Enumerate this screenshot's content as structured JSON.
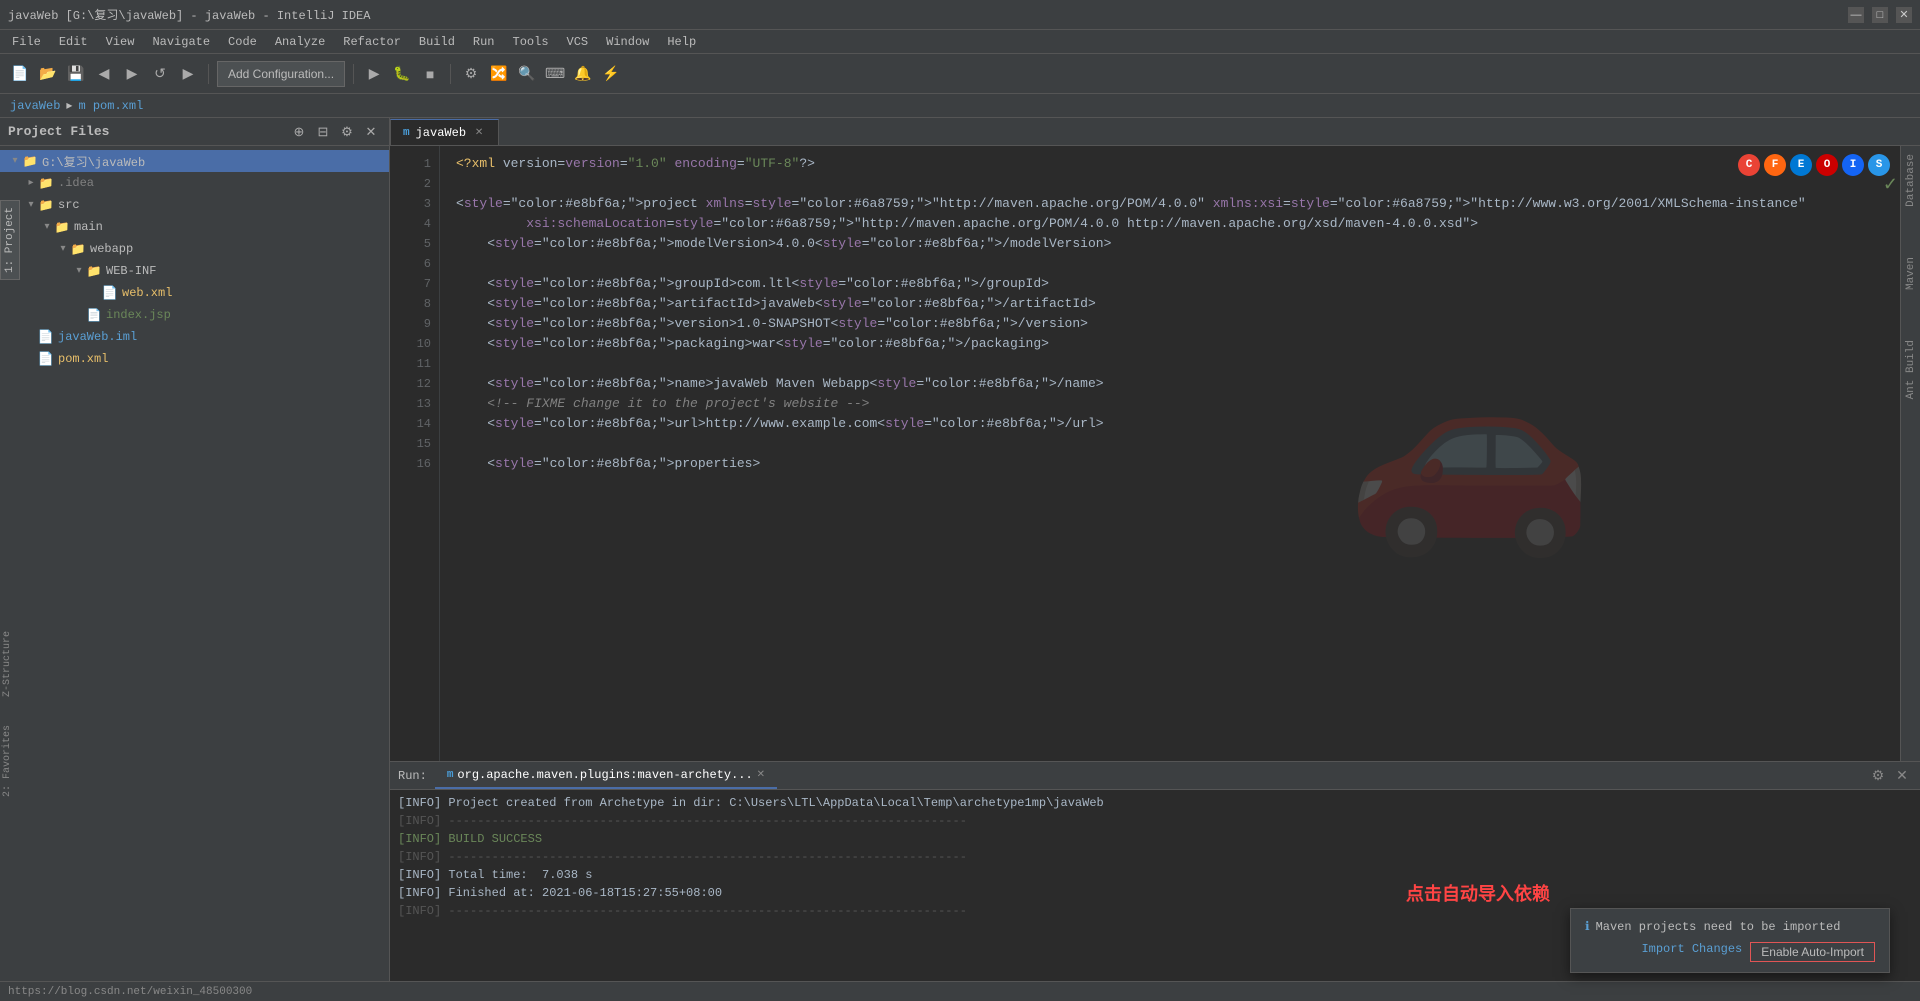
{
  "window": {
    "title": "javaWeb [G:\\复习\\javaWeb] - javaWeb - IntelliJ IDEA",
    "min_label": "—",
    "max_label": "□",
    "close_label": "✕"
  },
  "menu": {
    "items": [
      "File",
      "Edit",
      "View",
      "Navigate",
      "Code",
      "Analyze",
      "Refactor",
      "Build",
      "Run",
      "Tools",
      "VCS",
      "Window",
      "Help"
    ]
  },
  "toolbar": {
    "add_config_label": "Add Configuration...",
    "run_icon": "▶",
    "debug_icon": "🐛",
    "stop_icon": "■",
    "build_icon": "🔨"
  },
  "breadcrumb": {
    "parts": [
      "javaWeb",
      "▸",
      "m pom.xml"
    ]
  },
  "sidebar": {
    "title": "Project Files",
    "tree": [
      {
        "indent": 0,
        "icon": "📁",
        "label": "G:\\复习\\javaWeb",
        "expanded": true,
        "arrow": "▾"
      },
      {
        "indent": 1,
        "icon": "📁",
        "label": ".idea",
        "expanded": false,
        "arrow": "▸"
      },
      {
        "indent": 1,
        "icon": "📁",
        "label": "src",
        "expanded": true,
        "arrow": "▾"
      },
      {
        "indent": 2,
        "icon": "📁",
        "label": "main",
        "expanded": true,
        "arrow": "▾"
      },
      {
        "indent": 3,
        "icon": "📁",
        "label": "webapp",
        "expanded": true,
        "arrow": "▾"
      },
      {
        "indent": 4,
        "icon": "📁",
        "label": "WEB-INF",
        "expanded": true,
        "arrow": "▾"
      },
      {
        "indent": 5,
        "icon": "📄",
        "label": "web.xml",
        "expanded": false,
        "arrow": ""
      },
      {
        "indent": 4,
        "icon": "📄",
        "label": "index.jsp",
        "expanded": false,
        "arrow": ""
      },
      {
        "indent": 1,
        "icon": "📄",
        "label": "javaWeb.iml",
        "expanded": false,
        "arrow": ""
      },
      {
        "indent": 1,
        "icon": "📄",
        "label": "pom.xml",
        "expanded": false,
        "arrow": ""
      }
    ]
  },
  "editor": {
    "tab_label": "javaWeb",
    "tab_icon": "m",
    "lines": [
      {
        "num": 1,
        "content": "<?xml version=\"1.0\" encoding=\"UTF-8\"?>"
      },
      {
        "num": 2,
        "content": ""
      },
      {
        "num": 3,
        "content": "<project xmlns=\"http://maven.apache.org/POM/4.0.0\" xmlns:xsi=\"http://www.w3.org/2001/XMLSchema-instance\""
      },
      {
        "num": 4,
        "content": "         xsi:schemaLocation=\"http://maven.apache.org/POM/4.0.0 http://maven.apache.org/xsd/maven-4.0.0.xsd\">"
      },
      {
        "num": 5,
        "content": "    <modelVersion>4.0.0</modelVersion>"
      },
      {
        "num": 6,
        "content": ""
      },
      {
        "num": 7,
        "content": "    <groupId>com.ltl</groupId>"
      },
      {
        "num": 8,
        "content": "    <artifactId>javaWeb</artifactId>"
      },
      {
        "num": 9,
        "content": "    <version>1.0-SNAPSHOT</version>"
      },
      {
        "num": 10,
        "content": "    <packaging>war</packaging>"
      },
      {
        "num": 11,
        "content": ""
      },
      {
        "num": 12,
        "content": "    <name>javaWeb Maven Webapp</name>"
      },
      {
        "num": 13,
        "content": "    <!-- FIXME change it to the project's website -->"
      },
      {
        "num": 14,
        "content": "    <url>http://www.example.com</url>"
      },
      {
        "num": 15,
        "content": ""
      },
      {
        "num": 16,
        "content": "    <properties>"
      }
    ]
  },
  "run_panel": {
    "tab_label": "org.apache.maven.plugins:maven-archety...",
    "run_prefix": "Run:",
    "console_lines": [
      {
        "text": "[INFO] Project created from Archetype in dir: C:\\Users\\LTL\\AppData\\Local\\Temp\\archetype1mp\\javaWeb",
        "type": "info"
      },
      {
        "text": "[INFO] ------------------------------------------------------------------------",
        "type": "separator"
      },
      {
        "text": "[INFO] BUILD SUCCESS",
        "type": "success"
      },
      {
        "text": "[INFO] ------------------------------------------------------------------------",
        "type": "separator"
      },
      {
        "text": "[INFO] Total time:  7.038 s",
        "type": "info"
      },
      {
        "text": "[INFO] Finished at: 2021-06-18T15:27:55+08:00",
        "type": "info"
      },
      {
        "text": "[INFO] ------------------------------------------------------------------------",
        "type": "separator"
      }
    ]
  },
  "import_notification": {
    "icon": "ℹ",
    "title": "Maven projects need to be imported",
    "import_changes_label": "Import Changes",
    "enable_auto_import_label": "Enable Auto-Import"
  },
  "annotation": {
    "text": "点击自动导入依赖"
  },
  "url_bar": {
    "url": "https://blog.csdn.net/weixin_48500300"
  },
  "browser_icons": [
    {
      "name": "chrome",
      "color": "#ea4335",
      "label": "C"
    },
    {
      "name": "firefox",
      "color": "#ff6611",
      "label": "F"
    },
    {
      "name": "edge",
      "color": "#0078d4",
      "label": "E"
    },
    {
      "name": "opera",
      "color": "#cc0000",
      "label": "O"
    },
    {
      "name": "ie",
      "color": "#1464f4",
      "label": "I"
    },
    {
      "name": "safari",
      "color": "#2996e8",
      "label": "S"
    }
  ],
  "right_tabs": [
    "Database",
    "Maven",
    "Ant Build"
  ],
  "sidebar_left_tabs": [
    "1: Project",
    "2: Favorites",
    "Z-Structure"
  ]
}
